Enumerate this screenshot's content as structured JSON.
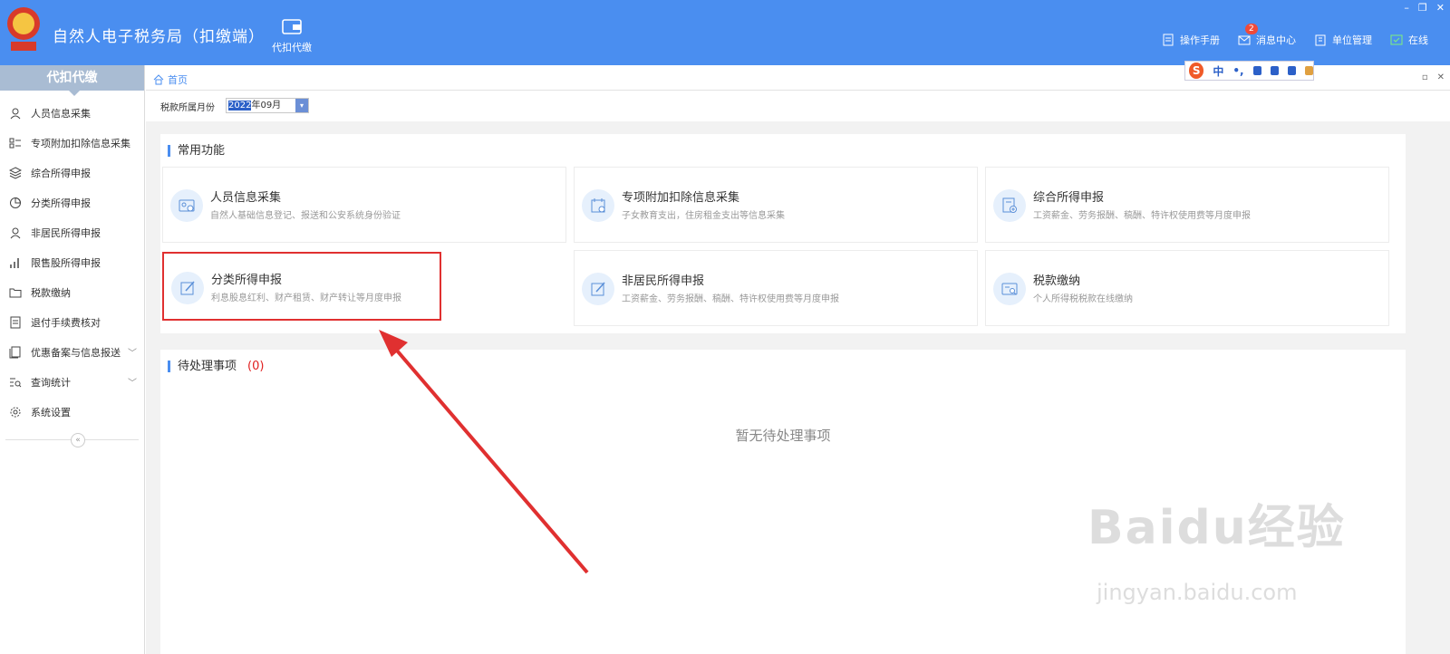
{
  "app": {
    "title": "自然人电子税务局（扣缴端）",
    "top_nav": [
      {
        "label": "代扣代缴",
        "icon": "wallet-icon"
      }
    ],
    "actions": [
      {
        "label": "操作手册",
        "icon": "manual-icon"
      },
      {
        "label": "消息中心",
        "icon": "mail-icon",
        "badge": "2"
      },
      {
        "label": "单位管理",
        "icon": "building-icon"
      },
      {
        "label": "在线",
        "icon": "online-icon"
      }
    ],
    "window": {
      "minimize": "–",
      "restore": "❐",
      "close": "✕"
    }
  },
  "sidebar": {
    "header": "代扣代缴",
    "items": [
      {
        "label": "人员信息采集",
        "icon": "person-icon"
      },
      {
        "label": "专项附加扣除信息采集",
        "icon": "list-icon"
      },
      {
        "label": "综合所得申报",
        "icon": "layers-icon"
      },
      {
        "label": "分类所得申报",
        "icon": "pie-icon"
      },
      {
        "label": "非居民所得申报",
        "icon": "person-icon"
      },
      {
        "label": "限售股所得申报",
        "icon": "bar-chart-icon"
      },
      {
        "label": "税款缴纳",
        "icon": "folder-icon"
      },
      {
        "label": "退付手续费核对",
        "icon": "document-icon"
      },
      {
        "label": "优惠备案与信息报送",
        "icon": "copy-icon",
        "expandable": true
      },
      {
        "label": "查询统计",
        "icon": "search-list-icon",
        "expandable": true
      },
      {
        "label": "系统设置",
        "icon": "gear-icon"
      }
    ],
    "collapse": "«"
  },
  "tabs": {
    "home": "首页"
  },
  "ime": {
    "logo": "S",
    "lang": "中",
    "punct": "•,"
  },
  "filter": {
    "label": "税款所属月份",
    "year": "2022",
    "rest": "年09月"
  },
  "common": {
    "title": "常用功能",
    "cards": [
      {
        "title": "人员信息采集",
        "desc": "自然人基础信息登记、报送和公安系统身份验证",
        "icon": "id-card-icon"
      },
      {
        "title": "专项附加扣除信息采集",
        "desc": "子女教育支出，住房租金支出等信息采集",
        "icon": "calendar-check-icon"
      },
      {
        "title": "综合所得申报",
        "desc": "工资薪金、劳务报酬、稿酬、特许权使用费等月度申报",
        "icon": "doc-plus-icon"
      },
      {
        "title": "分类所得申报",
        "desc": "利息股息红利、财产租赁、财产转让等月度申报",
        "icon": "edit-icon"
      },
      {
        "title": "非居民所得申报",
        "desc": "工资薪金、劳务报酬、稿酬、特许权使用费等月度申报",
        "icon": "edit-icon"
      },
      {
        "title": "税款缴纳",
        "desc": "个人所得税税款在线缴纳",
        "icon": "id-search-icon"
      }
    ]
  },
  "pending": {
    "title": "待处理事项",
    "count": "(0)",
    "empty": "暂无待处理事项"
  },
  "watermark": {
    "main": "Baidu经验",
    "sub": "jingyan.baidu.com"
  },
  "colors": {
    "topbar": "#4a8ef0",
    "accent": "#4a8ef0",
    "highlight": "#e03030"
  }
}
